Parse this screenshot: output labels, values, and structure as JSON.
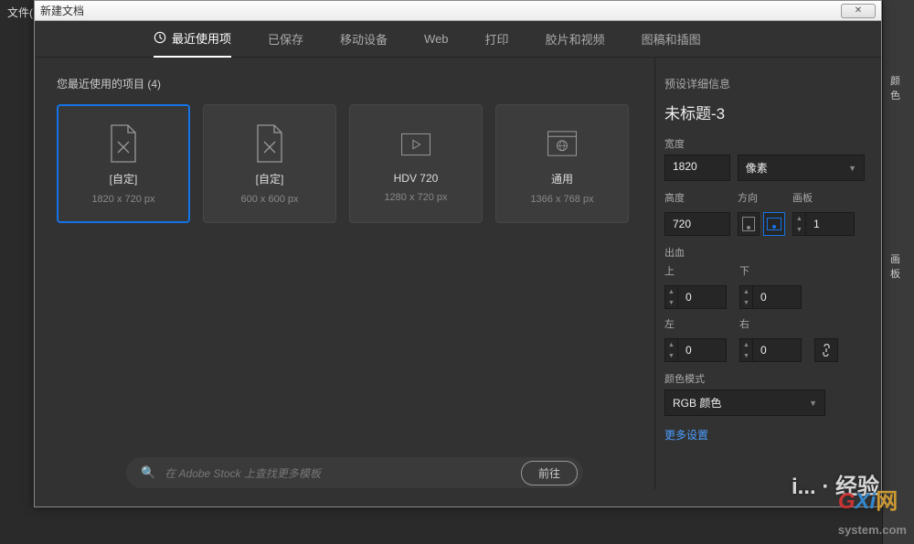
{
  "bg": {
    "menu": "文件(F)",
    "panel1": "颜色",
    "panel2": "画板"
  },
  "dialog": {
    "title": "新建文档",
    "close": "✕"
  },
  "tabs": [
    {
      "label": "最近使用项",
      "active": true
    },
    {
      "label": "已保存"
    },
    {
      "label": "移动设备"
    },
    {
      "label": "Web"
    },
    {
      "label": "打印"
    },
    {
      "label": "胶片和视频"
    },
    {
      "label": "图稿和插图"
    }
  ],
  "recent": {
    "title": "您最近使用的项目 (4)"
  },
  "presets": [
    {
      "name": "[自定]",
      "dims": "1820 x 720 px",
      "selected": true,
      "icon": "doc"
    },
    {
      "name": "[自定]",
      "dims": "600 x 600 px",
      "icon": "doc"
    },
    {
      "name": "HDV 720",
      "dims": "1280 x 720 px",
      "icon": "play"
    },
    {
      "name": "通用",
      "dims": "1366 x 768 px",
      "icon": "web"
    }
  ],
  "details": {
    "title": "预设详细信息",
    "docName": "未标题-3",
    "widthLabel": "宽度",
    "width": "1820",
    "unit": "像素",
    "heightLabel": "高度",
    "height": "720",
    "orientLabel": "方向",
    "artboardLabel": "画板",
    "artboardCount": "1",
    "bleedLabel": "出血",
    "topLabel": "上",
    "bottomLabel": "下",
    "leftLabel": "左",
    "rightLabel": "右",
    "bleedTop": "0",
    "bleedBottom": "0",
    "bleedLeft": "0",
    "bleedRight": "0",
    "colorModeLabel": "颜色模式",
    "colorMode": "RGB 颜色",
    "moreSettings": "更多设置"
  },
  "search": {
    "placeholder": "在 Adobe Stock 上查找更多模板",
    "button": "前往"
  },
  "watermark": {
    "w1": "i... · 经验",
    "net": "网"
  }
}
